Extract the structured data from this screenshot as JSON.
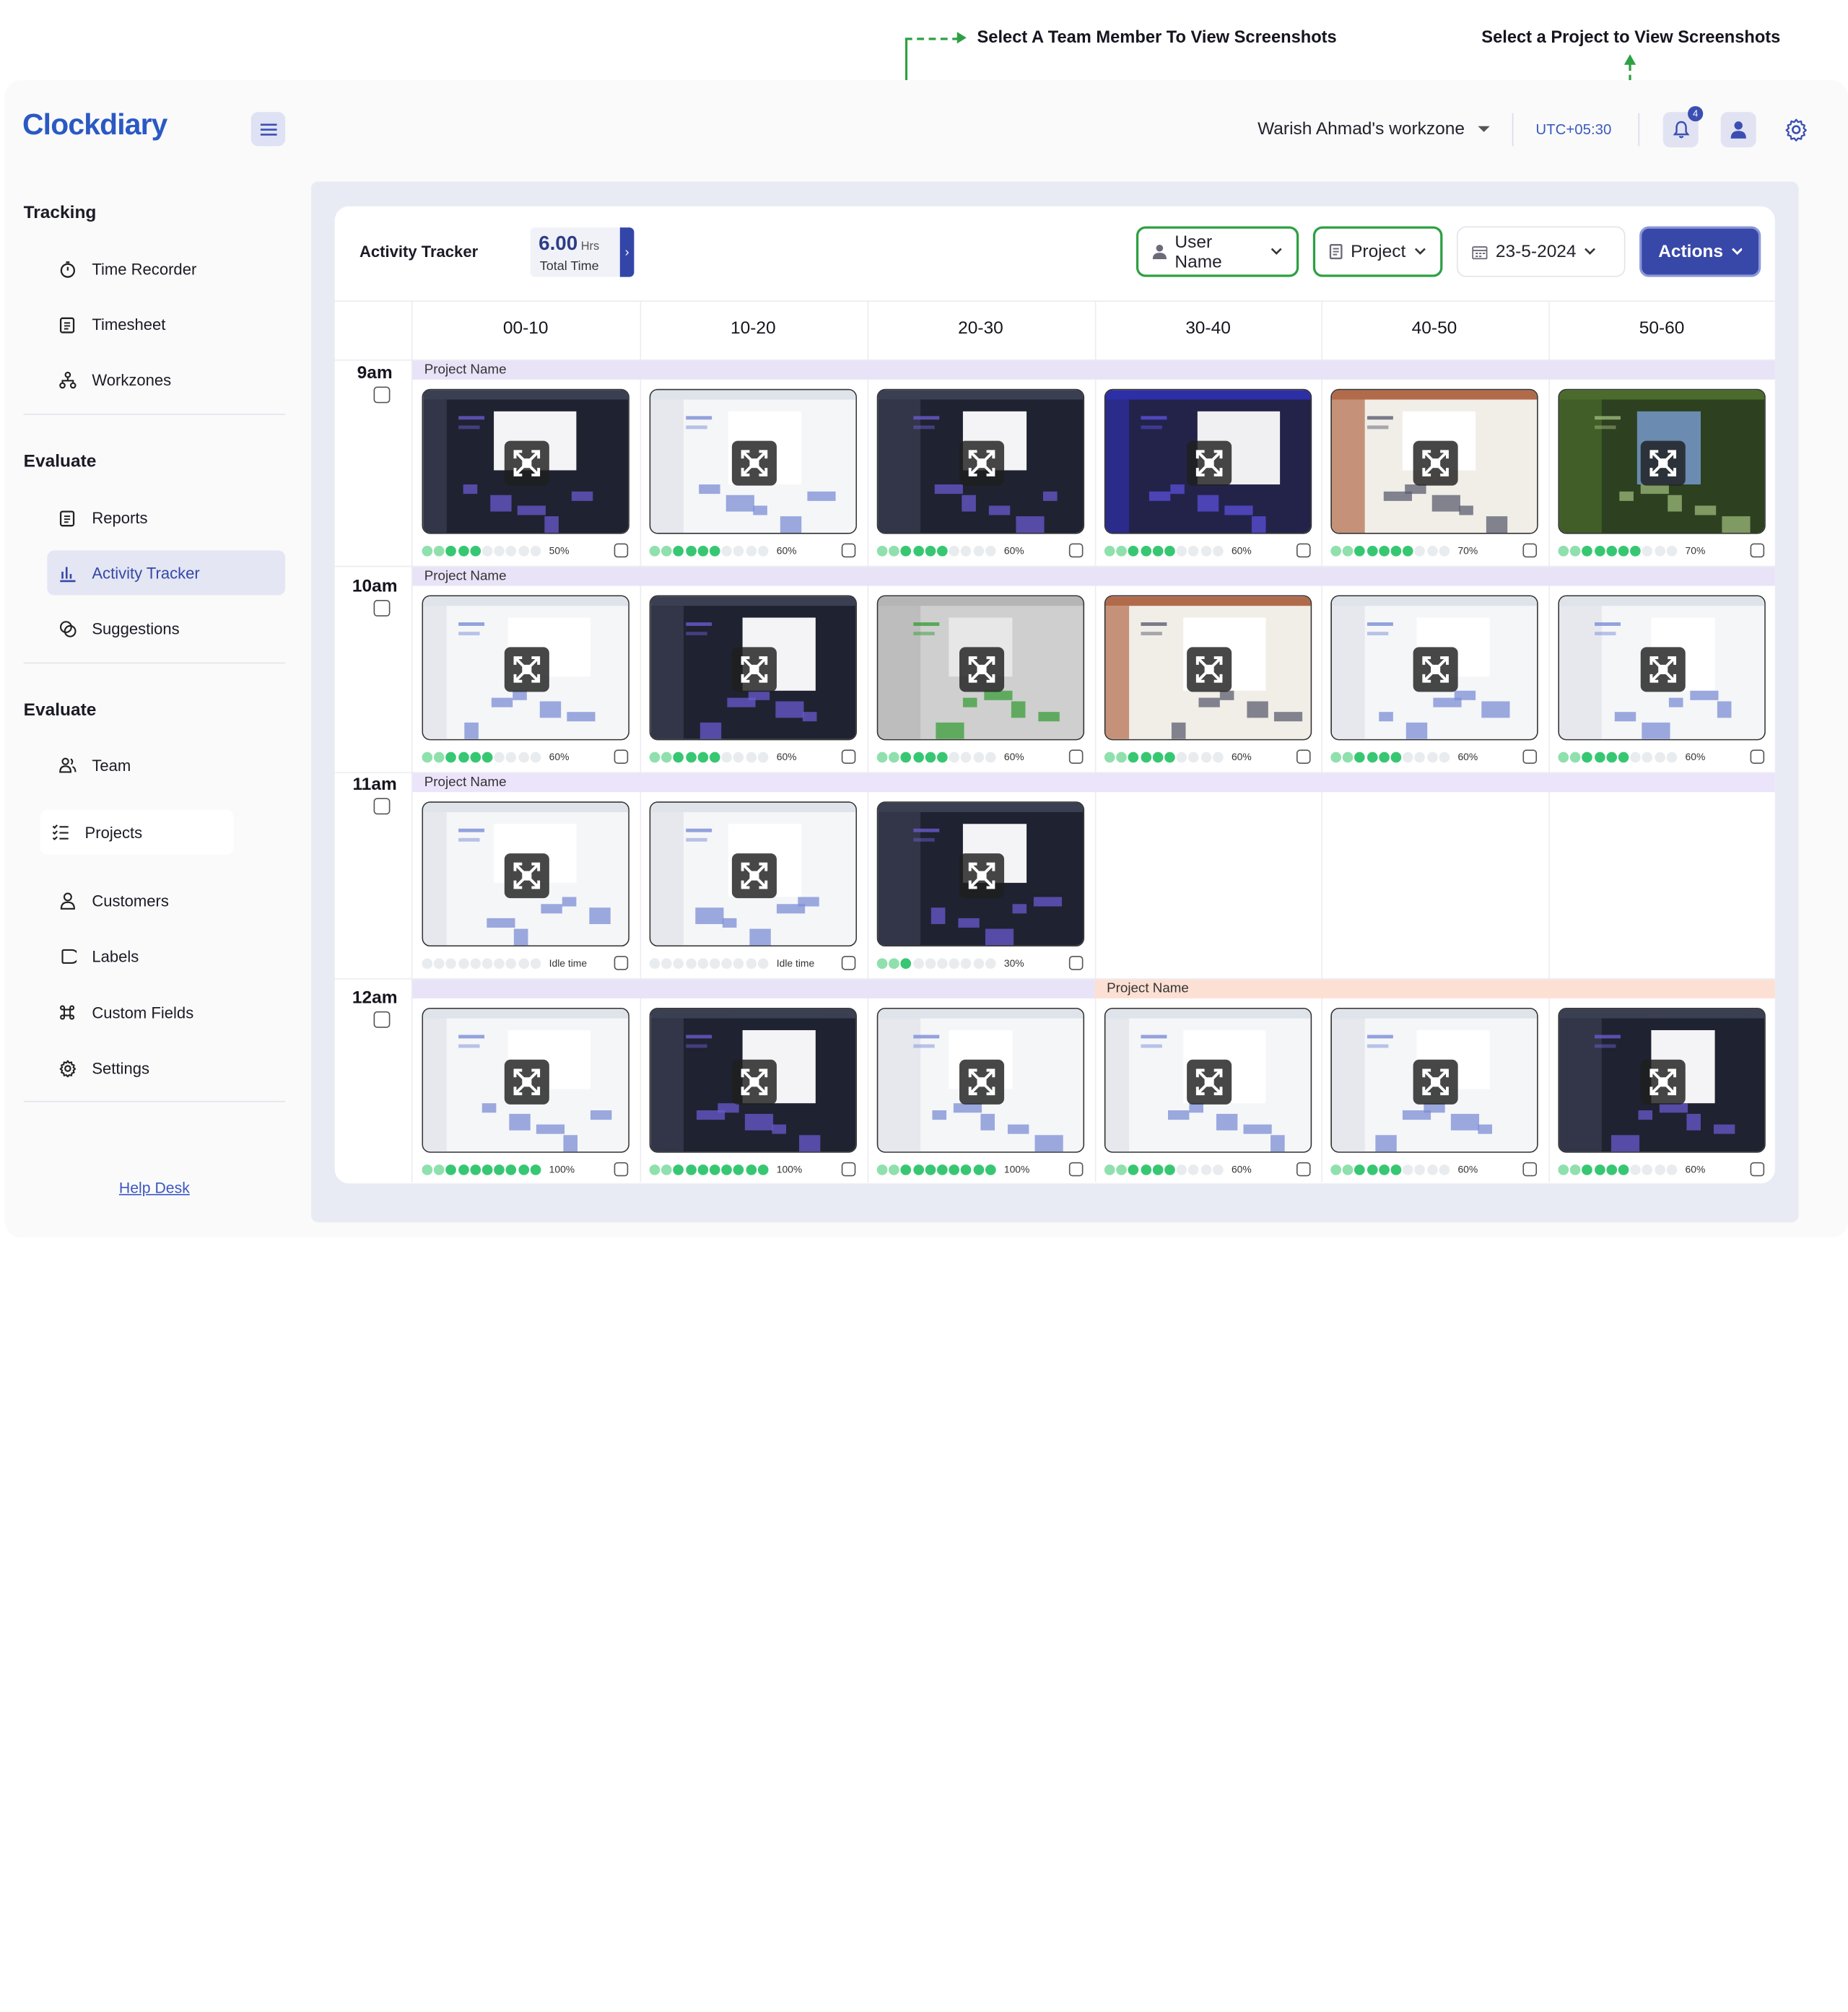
{
  "annotations": {
    "team_member": "Select A Team Member To View Screenshots",
    "project": "Select a Project to View Screenshots"
  },
  "brand": {
    "logo": "Clockdiary"
  },
  "sidebar": {
    "sections": [
      {
        "title": "Tracking",
        "items": [
          {
            "label": "Time Recorder",
            "icon": "stopwatch-icon"
          },
          {
            "label": "Timesheet",
            "icon": "clipboard-icon"
          },
          {
            "label": "Workzones",
            "icon": "network-icon"
          }
        ]
      },
      {
        "title": "Evaluate",
        "items": [
          {
            "label": "Reports",
            "icon": "clipboard-icon"
          },
          {
            "label": "Activity Tracker",
            "icon": "bar-chart-icon",
            "active": true
          },
          {
            "label": "Suggestions",
            "icon": "chat-icon"
          }
        ]
      },
      {
        "title": "Evaluate",
        "items": [
          {
            "label": "Team",
            "icon": "team-icon"
          },
          {
            "label": "Projects",
            "icon": "checklist-icon"
          },
          {
            "label": "Customers",
            "icon": "user-icon"
          },
          {
            "label": "Labels",
            "icon": "tag-icon"
          },
          {
            "label": "Custom Fields",
            "icon": "command-icon"
          },
          {
            "label": "Settings",
            "icon": "gear-icon"
          }
        ]
      }
    ],
    "help": "Help Desk"
  },
  "header": {
    "workspace": "Warish Ahmad's workzone",
    "timezone": "UTC+05:30",
    "notifications": "4"
  },
  "tracker": {
    "title": "Activity Tracker",
    "total_value": "6.00",
    "total_unit": "Hrs",
    "total_label": "Total Time",
    "user_filter": "User Name",
    "project_filter": "Project",
    "date": "23-5-2024",
    "actions": "Actions"
  },
  "columns": [
    "00-10",
    "10-20",
    "20-30",
    "30-40",
    "40-50",
    "50-60"
  ],
  "rows": [
    {
      "hour": "9am",
      "band": "Project Name",
      "cells": [
        {
          "pct": "50%",
          "on": 5,
          "theme": "dark"
        },
        {
          "pct": "60%",
          "on": 6,
          "theme": "light"
        },
        {
          "pct": "60%",
          "on": 6,
          "theme": "dark"
        },
        {
          "pct": "60%",
          "on": 6,
          "theme": "purple"
        },
        {
          "pct": "70%",
          "on": 7,
          "theme": "photo"
        },
        {
          "pct": "70%",
          "on": 7,
          "theme": "nature"
        }
      ]
    },
    {
      "hour": "10am",
      "band": "Project Name",
      "cells": [
        {
          "pct": "60%",
          "on": 6,
          "theme": "light"
        },
        {
          "pct": "60%",
          "on": 6,
          "theme": "dark"
        },
        {
          "pct": "60%",
          "on": 6,
          "theme": "grey"
        },
        {
          "pct": "60%",
          "on": 6,
          "theme": "photo"
        },
        {
          "pct": "60%",
          "on": 6,
          "theme": "light"
        },
        {
          "pct": "60%",
          "on": 6,
          "theme": "light"
        }
      ]
    },
    {
      "hour": "11am",
      "band": "Project Name",
      "cells": [
        {
          "pct": "Idle time",
          "on": 0,
          "theme": "light"
        },
        {
          "pct": "Idle time",
          "on": 0,
          "theme": "light"
        },
        {
          "pct": "30%",
          "on": 3,
          "theme": "dark"
        },
        null,
        null,
        null
      ]
    },
    {
      "hour": "12am",
      "band": "",
      "band2": "Project Name",
      "cells": [
        {
          "pct": "100%",
          "on": 10,
          "theme": "light"
        },
        {
          "pct": "100%",
          "on": 10,
          "theme": "dark"
        },
        {
          "pct": "100%",
          "on": 10,
          "theme": "light"
        },
        {
          "pct": "60%",
          "on": 6,
          "theme": "light"
        },
        {
          "pct": "60%",
          "on": 6,
          "theme": "light"
        },
        {
          "pct": "60%",
          "on": 6,
          "theme": "dark"
        }
      ]
    }
  ],
  "colors": {
    "accent": "#3848a8",
    "activity_green": "#37c772",
    "band_purple": "#e8e3f7",
    "band_peach": "#fde0d4",
    "annotation_green": "#2ea043"
  }
}
